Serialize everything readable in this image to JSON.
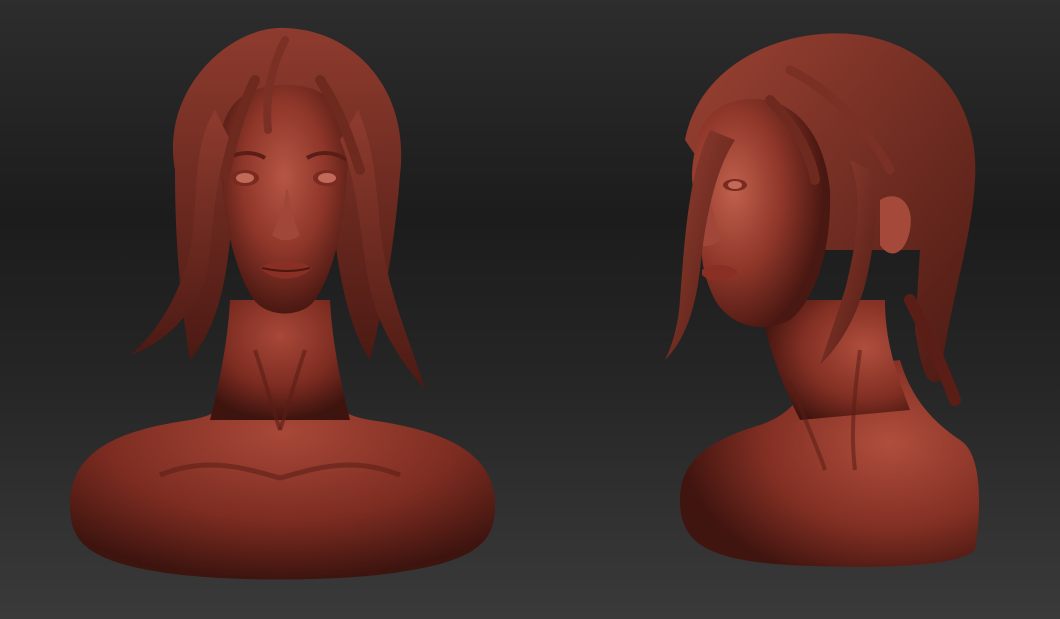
{
  "scene": {
    "subject": "sculpted bust",
    "views": [
      {
        "id": "front",
        "label": ""
      },
      {
        "id": "three-quarter",
        "label": ""
      }
    ]
  },
  "colors": {
    "background_top": "#2d2d2d",
    "background_bottom": "#3a3a3a",
    "clay_base": "#8a3428",
    "clay_highlight": "#c0604c",
    "clay_shadow": "#3a130f"
  }
}
